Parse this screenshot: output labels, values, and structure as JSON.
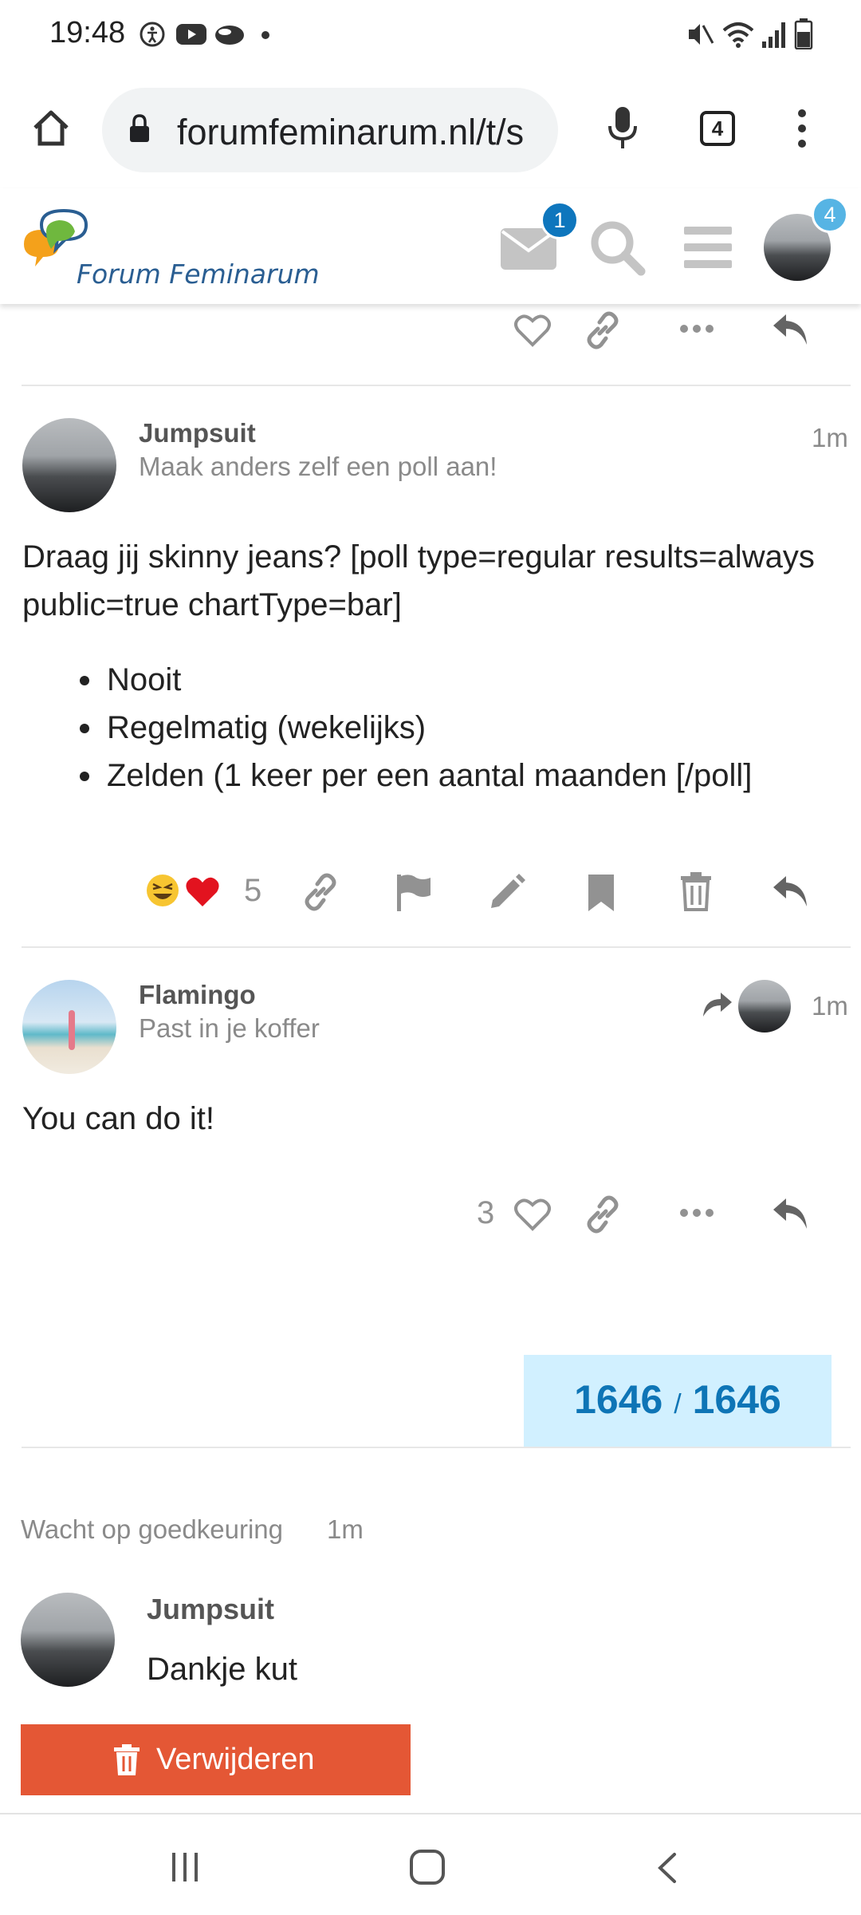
{
  "status_bar": {
    "time": "19:48"
  },
  "browser": {
    "url": "forumfeminarum.nl/t/s",
    "tab_count": "4"
  },
  "site": {
    "brand": "Forum Feminarum",
    "messages_badge": "1",
    "avatar_badge": "4"
  },
  "posts": [
    {
      "username": "Jumpsuit",
      "user_title": "Maak anders zelf een poll aan!",
      "time": "1m",
      "body": "Draag jij skinny jeans? [poll type=regular results=always public=true chartType=bar]",
      "list": [
        "Nooit",
        "Regelmatig (wekelijks)",
        "Zelden (1 keer per een aantal maanden [/poll]"
      ],
      "reaction_count": "5"
    },
    {
      "username": "Flamingo",
      "user_title": "Past in je koffer",
      "time": "1m",
      "body": "You can do it!",
      "like_count": "3"
    }
  ],
  "progress": {
    "current": "1646",
    "separator": "/",
    "total": "1646"
  },
  "pending": {
    "label": "Wacht op goedkeuring",
    "time": "1m",
    "username": "Jumpsuit",
    "body": "Dankje kut",
    "delete_label": "Verwijderen"
  },
  "colors": {
    "accent": "#0e75b6",
    "danger": "#e45735",
    "progress_bg": "#d1f0ff",
    "badge_blue": "#0e76bd",
    "badge_light": "#56b4e4"
  }
}
